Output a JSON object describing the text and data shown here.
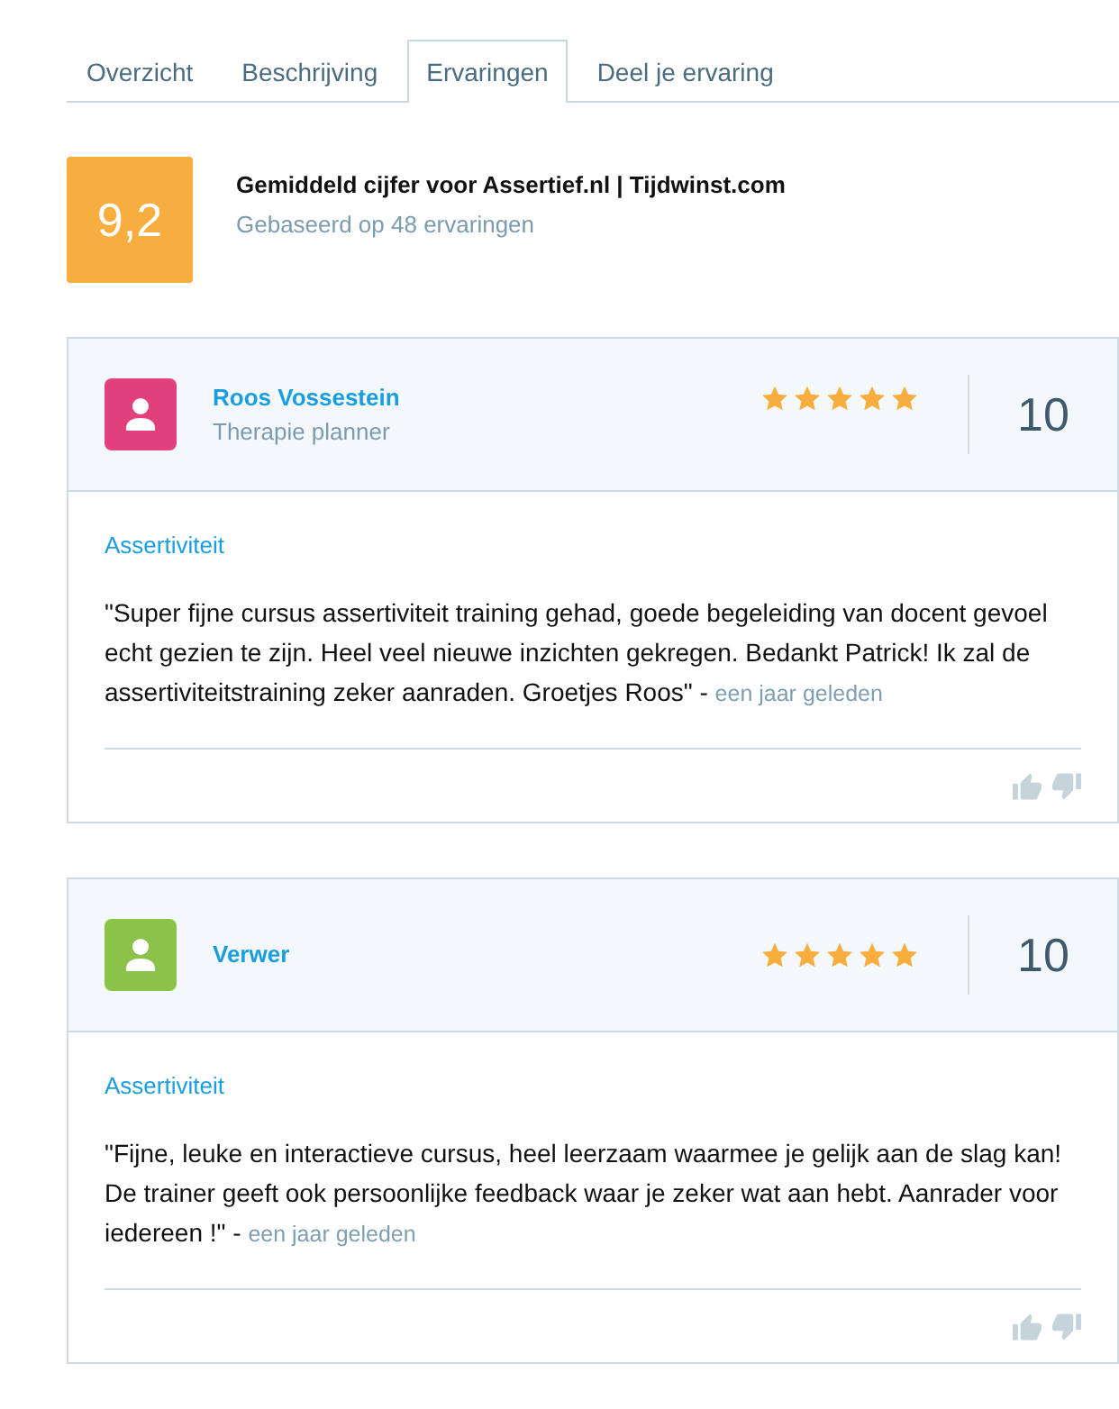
{
  "tabs": [
    {
      "label": "Overzicht",
      "selected": false
    },
    {
      "label": "Beschrijving",
      "selected": false
    },
    {
      "label": "Ervaringen",
      "selected": true
    },
    {
      "label": "Deel je ervaring",
      "selected": false
    }
  ],
  "summary": {
    "score": "9,2",
    "title": "Gemiddeld cijfer voor Assertief.nl | Tijdwinst.com",
    "subtitle": "Gebaseerd op 48 ervaringen"
  },
  "reviews": [
    {
      "name": "Roos Vossestein",
      "role": "Therapie planner",
      "color": "#e2407a",
      "stars": 5,
      "score": "10",
      "category": "Assertiviteit",
      "text": "\"Super fijne cursus assertiviteit training gehad, goede begeleiding van docent gevoel echt gezien te zijn. Heel veel nieuwe inzichten gekregen. Bedankt Patrick! Ik zal de assertiviteitstraining zeker aanraden. Groetjes Roos\" -",
      "time": "een jaar geleden"
    },
    {
      "name": "Verwer",
      "color": "#8bc34a",
      "stars": 5,
      "score": "10",
      "category": "Assertiviteit",
      "text": "\"Fijne, leuke en interactieve cursus, heel leerzaam waarmee je gelijk aan de slag kan! De trainer geeft ook persoonlijke feedback waar je zeker wat aan hebt. Aanrader voor iedereen !\" -",
      "time": "een jaar geleden"
    }
  ]
}
